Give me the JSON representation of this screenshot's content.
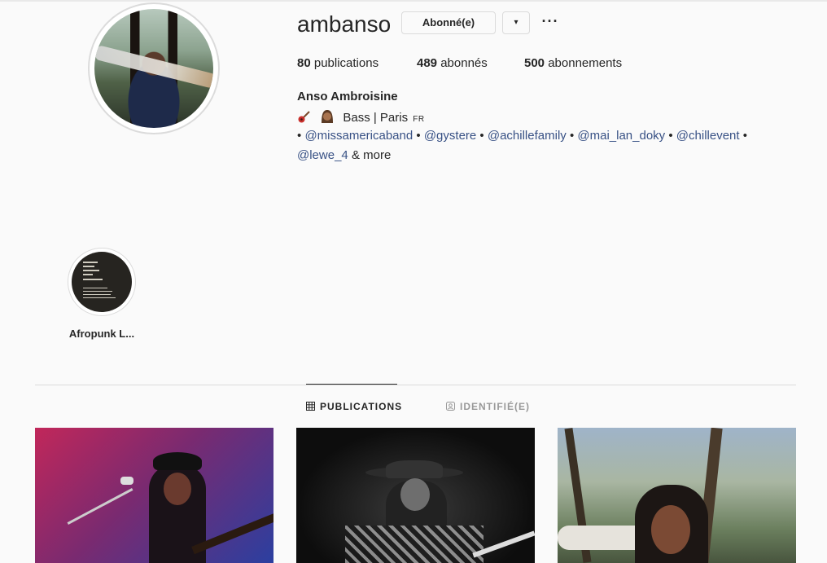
{
  "profile": {
    "username": "ambanso",
    "subscribed_label": "Abonné(e)",
    "dropdown_label": "▾",
    "more_label": "···",
    "stats": {
      "publications_count": "80",
      "publications_label": "publications",
      "followers_count": "489",
      "followers_label": "abonnés",
      "following_count": "500",
      "following_label": "abonnements"
    },
    "full_name": "Anso Ambroisine",
    "bio": {
      "line1_text": "Bass | Paris",
      "line1_flag": "FR",
      "mentions_line1": [
        "@missamericaband",
        "@gystere",
        "@achillefamily",
        "@mai_lan_doky",
        "@chillevent"
      ],
      "mention_line2": "@lewe_4",
      "bullet": "•",
      "more": "& more"
    }
  },
  "highlights": [
    {
      "label": "Afropunk L..."
    }
  ],
  "tabs": [
    {
      "label": "PUBLICATIONS",
      "icon": "grid-icon",
      "active": true
    },
    {
      "label": "IDENTIFIÉ(E)",
      "icon": "tagged-user-icon",
      "active": false
    }
  ],
  "colors": {
    "background": "#fafafa",
    "mention": "#385185",
    "border": "#dbdbdb",
    "text": "#262626",
    "muted": "#999999"
  }
}
